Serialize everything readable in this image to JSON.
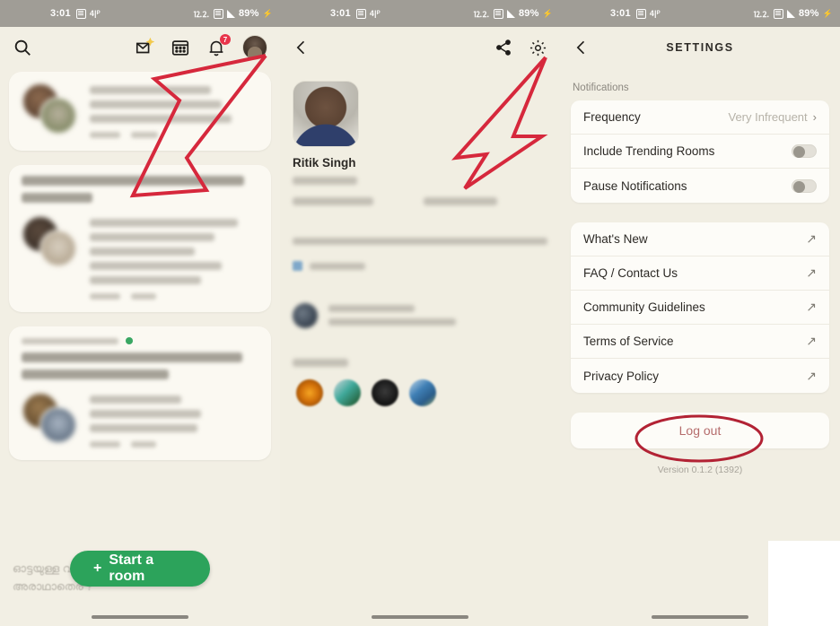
{
  "statusbar": {
    "time": "3:01",
    "battery": "89%",
    "charging_icon": "bolt-icon",
    "left_icons": [
      "screenshot-icon",
      "vpn-icon"
    ],
    "right_icons": [
      "dnd-icon",
      "sim-icon",
      "signal-icon",
      "battery-icon"
    ]
  },
  "panel_home": {
    "icons": {
      "search": "search-icon",
      "invite": "invite-envelope-icon",
      "calendar": "calendar-icon",
      "bell": "bell-icon",
      "avatar": "profile-avatar"
    },
    "notification_badge": "7",
    "cards": [
      {
        "title_blurred": true,
        "title_text": "",
        "speakers_blurred": [
          "Shweta Sason",
          "Vignesh Sridhar",
          "Santhosh Kumar"
        ],
        "meta_blurred": "231 2   24"
      },
      {
        "title_blurred": true,
        "title_text": "Mental Health — ways to cope and be better",
        "speakers_blurred": [
          "Khushboo Malhotra",
          "Shivani Bansal",
          "Srishti Kaul",
          "Aditya Raj Kaul",
          "Harish Kumar"
        ],
        "meta_blurred": "208 2   18"
      },
      {
        "live": true,
        "club_blurred": "SLEEP FICTION ROOM",
        "title_blurred": true,
        "title_text": "Sound Spa Ocean Ambience to Settle Your Sleep & Dreams",
        "speakers_blurred": [
          "Nikunj Ojha",
          "Affan Imran",
          "Ishq Bulleya"
        ],
        "meta_blurred": "199 2   8"
      }
    ],
    "start_room_label": "Start a room",
    "start_room_icon": "plus-icon",
    "start_room_color": "#2ca35b",
    "footer_text_line1": "ഓട്ടയുള്ള വാല്യത്തെ",
    "footer_text_line2": "അരാഥാതെര ?"
  },
  "panel_profile": {
    "back_icon": "chevron-left-icon",
    "share_icon": "share-icon",
    "settings_icon": "gear-icon",
    "name": "Ritik Singh",
    "handle_blurred": "@ritiksingh",
    "followers_blurred": "250 followers",
    "following_blurred": "88 following",
    "bio_blurred": "Motorcycle Enthusiast | Gadget Lover | Blogger",
    "twitter_blurred": "@Ritik31Singh",
    "joined_blurred": "Joined Feb 9, 2022",
    "nominated_blurred": "Nominated by Manoj Samal",
    "member_of_label_blurred": "Member of",
    "clubs": [
      "club-orange",
      "club-teal",
      "club-black",
      "club-blue"
    ]
  },
  "panel_settings": {
    "back_icon": "chevron-left-icon",
    "title": "SETTINGS",
    "section_label": "Notifications",
    "notification_rows": [
      {
        "label": "Frequency",
        "value": "Very Infrequent",
        "control": "chevron"
      },
      {
        "label": "Include Trending Rooms",
        "value": "",
        "control": "toggle",
        "on": false
      },
      {
        "label": "Pause Notifications",
        "value": "",
        "control": "toggle",
        "on": false
      }
    ],
    "link_rows": [
      {
        "label": "What's New",
        "control": "external-link"
      },
      {
        "label": "FAQ / Contact Us",
        "control": "external-link"
      },
      {
        "label": "Community Guidelines",
        "control": "external-link"
      },
      {
        "label": "Terms of Service",
        "control": "external-link"
      },
      {
        "label": "Privacy Policy",
        "control": "external-link"
      }
    ],
    "logout_label": "Log out",
    "logout_color": "#b56c6c",
    "version": "Version 0.1.2 (1392)"
  },
  "annotations": {
    "color": "#d6283c",
    "ellipse_color": "#b22234",
    "items": [
      {
        "type": "arrow",
        "target": "profile-avatar-header"
      },
      {
        "type": "arrow",
        "target": "gear-icon"
      },
      {
        "type": "ellipse",
        "target": "logout-button"
      }
    ]
  }
}
